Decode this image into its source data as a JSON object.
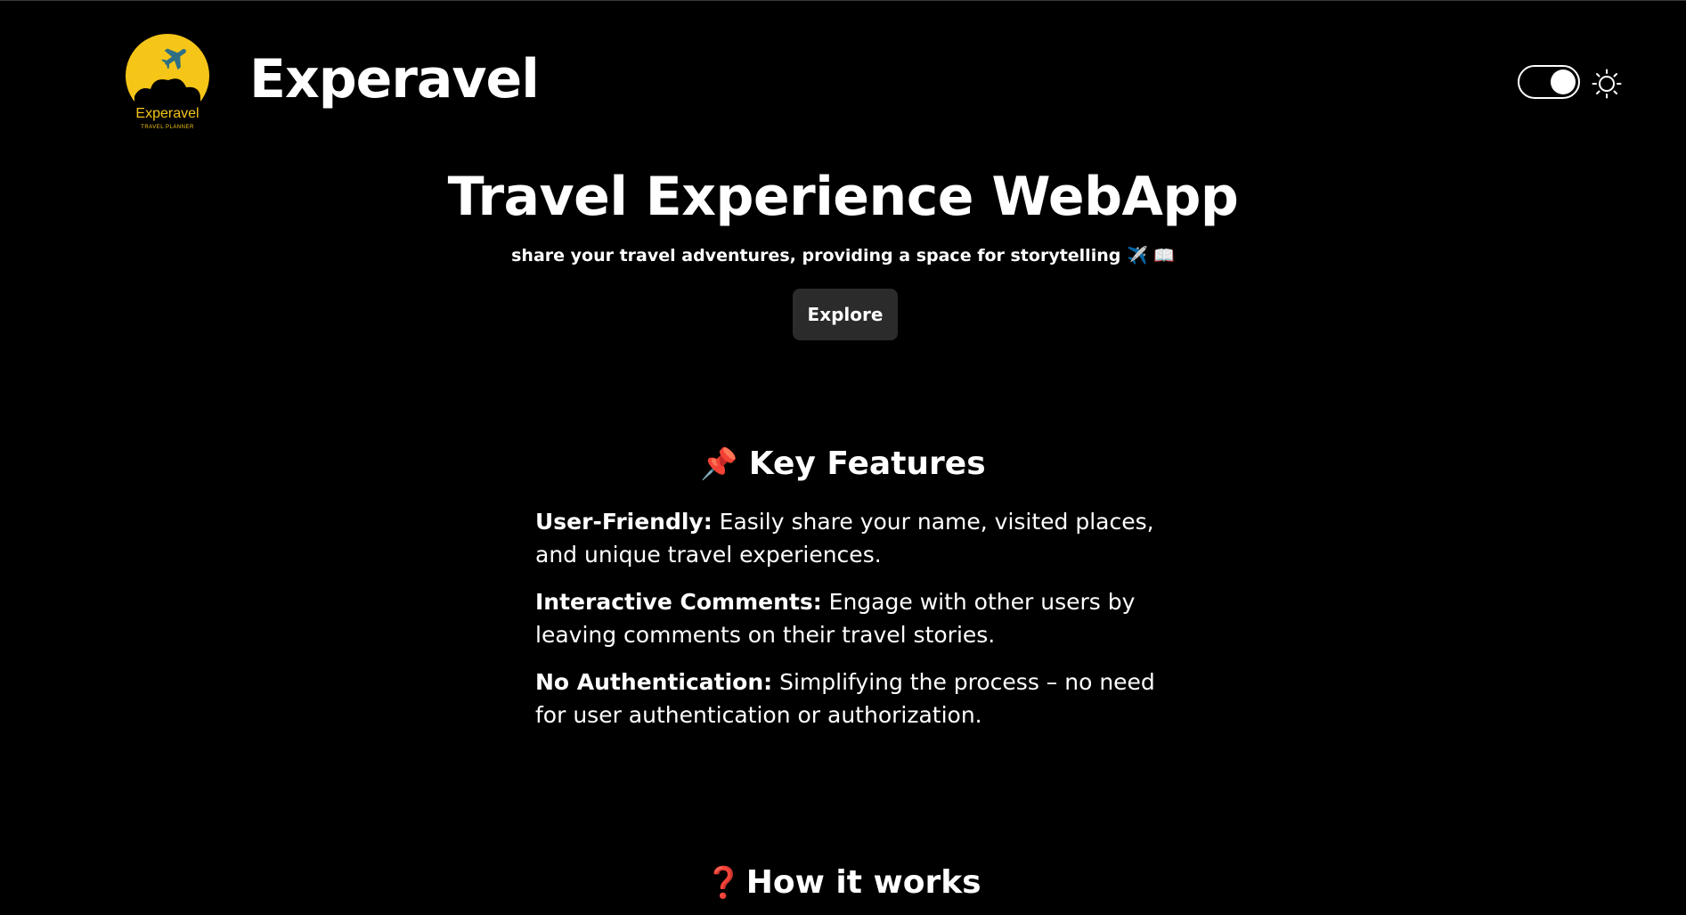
{
  "header": {
    "logo_text": "Experavel",
    "logo_subtext": "TRAVEL PLANNER",
    "brand": "Experavel",
    "theme_toggle_state": "on"
  },
  "hero": {
    "title": "Travel Experience WebApp",
    "subtitle": "share your travel adventures, providing a space for storytelling ✈️ 📖",
    "button": "Explore"
  },
  "key_features": {
    "emoji": "📌",
    "title": "Key Features",
    "items": [
      {
        "label": "User-Friendly:",
        "text": " Easily share your name, visited places, and unique travel experiences."
      },
      {
        "label": "Interactive Comments:",
        "text": " Engage with other users by leaving comments on their travel stories."
      },
      {
        "label": "No Authentication:",
        "text": " Simplifying the process – no need for user authentication or authorization."
      }
    ]
  },
  "how_it_works": {
    "emoji": "❓",
    "title": "How it works"
  },
  "colors": {
    "background": "#000000",
    "text": "#ffffff",
    "button_bg": "#2b2b2b",
    "logo_yellow": "#f5c518"
  }
}
